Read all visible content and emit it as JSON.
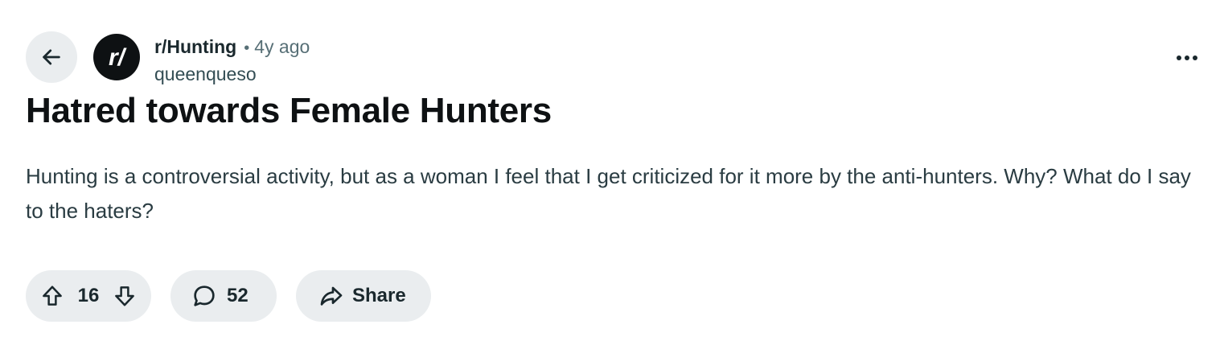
{
  "post": {
    "subreddit": "r/Hunting",
    "separator": "•",
    "age": "4y ago",
    "author": "queenqueso",
    "avatar_text": "r/",
    "title": "Hatred towards Female Hunters",
    "body": "Hunting is a controversial activity, but as a woman I feel that I get criticized for it more by the anti-hunters. Why? What do I say to the haters?"
  },
  "actions": {
    "vote_count": "16",
    "comment_count": "52",
    "share_label": "Share"
  },
  "icons": {
    "back": "arrow-left-icon",
    "more": "ellipsis-icon",
    "upvote": "arrow-up-icon",
    "downvote": "arrow-down-icon",
    "comment": "speech-bubble-icon",
    "share": "share-arrow-icon"
  },
  "colors": {
    "pill_background": "#eaedef",
    "text_primary": "#0e1113",
    "text_secondary": "#576f76",
    "avatar_background": "#0e1113"
  }
}
